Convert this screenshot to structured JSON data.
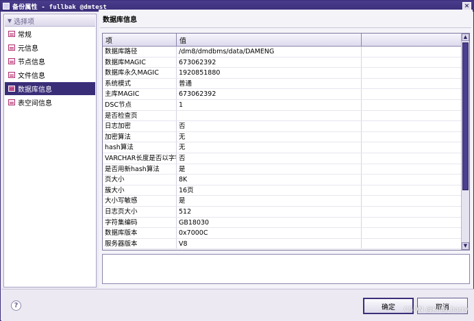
{
  "window": {
    "title": "备份属性 - fullbak @dmtest",
    "close_glyph": "×"
  },
  "sidebar": {
    "header": "选择项",
    "items": [
      {
        "label": "常规"
      },
      {
        "label": "元信息"
      },
      {
        "label": "节点信息"
      },
      {
        "label": "文件信息"
      },
      {
        "label": "数据库信息",
        "active": true
      },
      {
        "label": "表空间信息"
      }
    ]
  },
  "main": {
    "section_title": "数据库信息",
    "table": {
      "headers": [
        "项",
        "值"
      ],
      "rows": [
        [
          "数据库路径",
          "/dm8/dmdbms/data/DAMENG"
        ],
        [
          "数据库MAGIC",
          "673062392"
        ],
        [
          "数据库永久MAGIC",
          "1920851880"
        ],
        [
          "系统模式",
          "普通"
        ],
        [
          "主库MAGIC",
          "673062392"
        ],
        [
          "DSC节点",
          "1"
        ],
        [
          "是否检查页",
          ""
        ],
        [
          "日志加密",
          "否"
        ],
        [
          "加密算法",
          "无"
        ],
        [
          "hash算法",
          "无"
        ],
        [
          "VARCHAR长度是否以字符",
          "否"
        ],
        [
          "是否用新hash算法",
          "是"
        ],
        [
          "页大小",
          "8K"
        ],
        [
          "簇大小",
          "16页"
        ],
        [
          "大小写敏感",
          "是"
        ],
        [
          "日志页大小",
          "512"
        ],
        [
          "字符集编码",
          "GB18030"
        ],
        [
          "数据库版本",
          "0x7000C"
        ],
        [
          "服务器版本",
          "V8"
        ]
      ]
    },
    "description": ""
  },
  "footer": {
    "help_glyph": "?",
    "ok_label": "确定",
    "cancel_label": "取消",
    "watermark": "CSDN @king_harry"
  },
  "colors": {
    "accent": "#3a2d78",
    "titlebar": "#4a3c8c",
    "scroll_thumb": "#4b3f8f"
  }
}
